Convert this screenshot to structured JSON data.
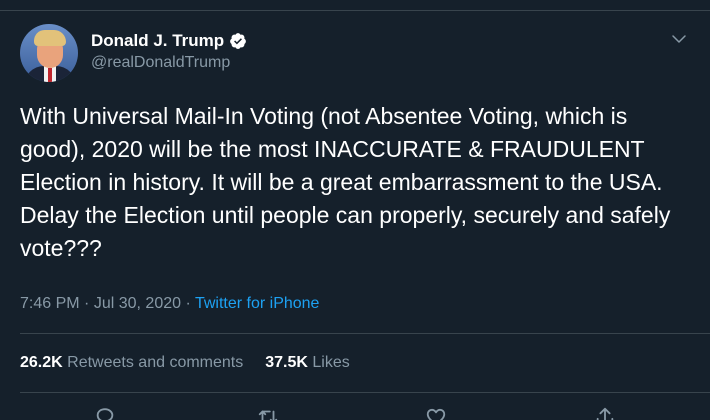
{
  "author": {
    "display_name": "Donald J. Trump",
    "handle": "@realDonaldTrump",
    "verified": true
  },
  "tweet": {
    "text": "With Universal Mail-In Voting (not Absentee Voting, which is good), 2020 will be the most INACCURATE & FRAUDULENT Election in history. It will be a great embarrassment to the USA. Delay the Election until people can properly, securely and safely vote???"
  },
  "meta": {
    "time": "7:46 PM",
    "separator": "·",
    "date": "Jul 30, 2020",
    "source": "Twitter for iPhone"
  },
  "stats": {
    "retweets_count": "26.2K",
    "retweets_label": "Retweets and comments",
    "likes_count": "37.5K",
    "likes_label": "Likes"
  },
  "icons": {
    "verified": "verified-badge-icon",
    "more": "chevron-down-icon",
    "reply": "reply-icon",
    "retweet": "retweet-icon",
    "like": "heart-icon",
    "share": "share-icon"
  },
  "colors": {
    "background": "#15202b",
    "text": "#ffffff",
    "secondary_text": "#8899a6",
    "link": "#1da1f2",
    "border": "#38444d"
  }
}
